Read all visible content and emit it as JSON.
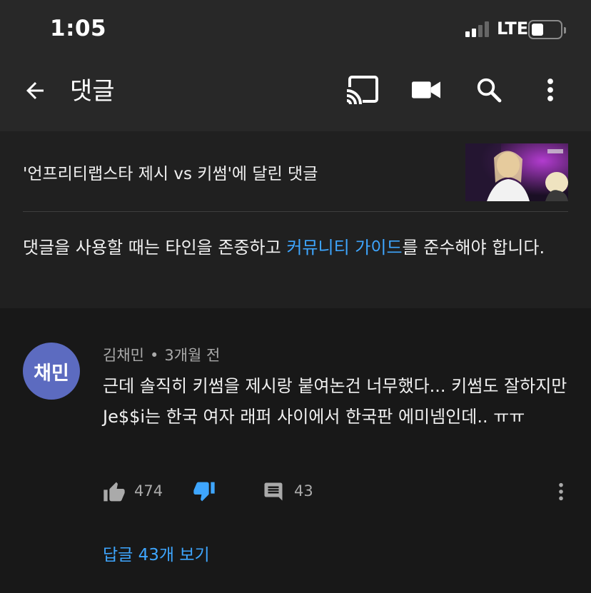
{
  "status": {
    "time": "1:05",
    "network": "LTE"
  },
  "app_bar": {
    "title": "댓글",
    "icons": [
      "back-arrow-icon",
      "cast-icon",
      "video-camera-icon",
      "search-icon",
      "more-vertical-icon"
    ]
  },
  "info": {
    "video_line": "'언프리티랩스타 제시 vs 키썸'에 달린 댓글",
    "guideline_prefix": "댓글을 사용할 때는 타인을 존중하고 ",
    "guideline_link": "커뮤니티 가이드",
    "guideline_suffix": "를 준수해야 합니다."
  },
  "comment": {
    "avatar_text": "채민",
    "author": "김채민",
    "separator": "•",
    "time": "3개월 전",
    "text": "근데 솔직히 키썸을 제시랑 붙여논건 너무했다... 키썸도 잘하지만 Je$$i는 한국 여자 래퍼 사이에서 한국판 에미넴인데.. ㅠㅠ",
    "likes": "474",
    "replies": "43",
    "view_replies": "답글 43개 보기",
    "disliked": true
  },
  "colors": {
    "background": "#181818",
    "header": "#282828",
    "panel": "#202020",
    "link": "#3ea6ff",
    "avatar": "#5c6bc0",
    "secondary_text": "#aaaaaa"
  }
}
